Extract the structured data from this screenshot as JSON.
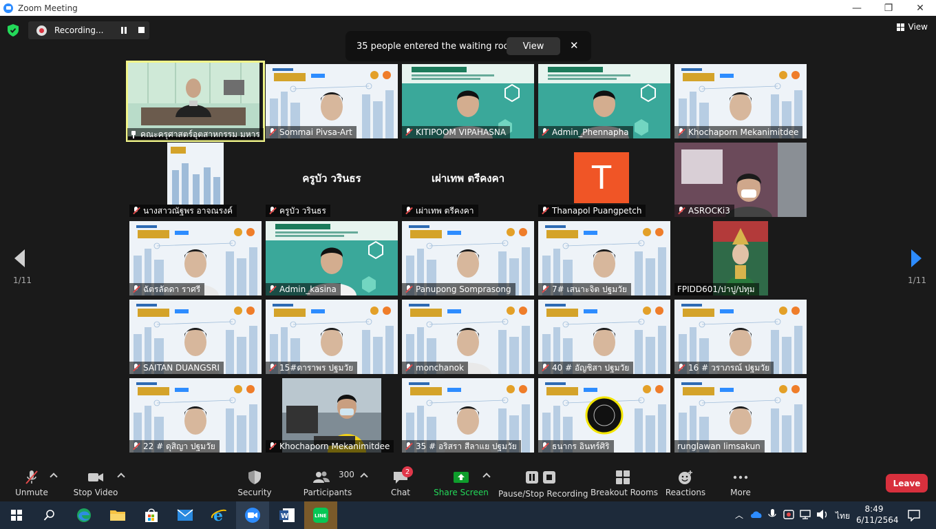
{
  "window": {
    "title": "Zoom Meeting",
    "minimize_glyph": "—",
    "maximize_glyph": "❐",
    "close_glyph": "✕"
  },
  "recording": {
    "label": "Recording..."
  },
  "view": {
    "label": "View"
  },
  "notification": {
    "message": "35 people entered the waiting room",
    "action": "View",
    "close_glyph": "✕"
  },
  "pagination": {
    "left_label": "1/11",
    "right_label": "1/11"
  },
  "colors": {
    "accent": "#2d8cff",
    "active_speaker": "#f1f58a",
    "leave": "#d8303d",
    "share": "#0e9d2c"
  },
  "participants": [
    {
      "name": "คณะครุศาสตร์อุตสาหกรรม มหาร...",
      "muted": false,
      "pinned": true,
      "video": "room"
    },
    {
      "name": "Sommai Pivsa-Art",
      "muted": true,
      "video": "slide"
    },
    {
      "name": "KITIPOOM VIPAHASNA",
      "muted": true,
      "video": "teal"
    },
    {
      "name": "Admin_Phennapha",
      "muted": true,
      "video": "teal"
    },
    {
      "name": "Khochaporn Mekanimitdee",
      "muted": true,
      "video": "slide"
    },
    {
      "name": "นางสาวณัฐพร อาจณรงค์",
      "muted": true,
      "video": "slide_small"
    },
    {
      "name": "ครูบัว วรินธร",
      "muted": true,
      "video": "none",
      "display": "ครูบัว วรินธร"
    },
    {
      "name": "เผ่าเทพ ตรีคงคา",
      "muted": true,
      "video": "none",
      "display": "เผ่าเทพ ตรีคงคา"
    },
    {
      "name": "Thanapol Puangpetch",
      "muted": true,
      "video": "avatar",
      "avatar_letter": "T"
    },
    {
      "name": "ASROCKi3",
      "muted": true,
      "video": "room_purple"
    },
    {
      "name": "ฉัตรลัดดา ราศรี",
      "muted": true,
      "video": "slide"
    },
    {
      "name": "Admin_kasina",
      "muted": true,
      "video": "teal"
    },
    {
      "name": "Panupong Somprasong",
      "muted": true,
      "video": "slide"
    },
    {
      "name": "7# เสนาะจิต ปฐมวัย",
      "muted": true,
      "video": "slide"
    },
    {
      "name": "FPIDD601/ปาปู/ปทุม",
      "muted": false,
      "video": "portrait"
    },
    {
      "name": "SAITAN DUANGSRI",
      "muted": true,
      "video": "slide"
    },
    {
      "name": "15#ดาราพร ปฐมวัย",
      "muted": true,
      "video": "slide"
    },
    {
      "name": "monchanok",
      "muted": true,
      "video": "slide"
    },
    {
      "name": "40 # อัญชิสา ปฐมวัย",
      "muted": true,
      "video": "slide"
    },
    {
      "name": "16 # วราภรณ์ ปฐมวัย",
      "muted": true,
      "video": "slide"
    },
    {
      "name": "22 # ดุสิญา ปฐมวัย",
      "muted": true,
      "video": "slide"
    },
    {
      "name": "Khochaporn Mekanimitdee",
      "muted": true,
      "video": "office"
    },
    {
      "name": "35 # อริสรา สีลาแย ปฐมวัย",
      "muted": true,
      "video": "slide"
    },
    {
      "name": "ธนากร อินทร์ศิริ",
      "muted": true,
      "video": "slide_logo"
    },
    {
      "name": "runglawan limsakun",
      "muted": false,
      "video": "slide"
    }
  ],
  "toolbar": {
    "unmute": "Unmute",
    "stop_video": "Stop Video",
    "security": "Security",
    "participants": "Participants",
    "participants_count": "300",
    "chat": "Chat",
    "chat_badge": "2",
    "share_screen": "Share Screen",
    "pause_stop_recording": "Pause/Stop Recording",
    "breakout_rooms": "Breakout Rooms",
    "reactions": "Reactions",
    "more": "More",
    "leave": "Leave"
  },
  "taskbar": {
    "language": "ไทย",
    "time": "8:49",
    "date": "6/11/2564"
  }
}
